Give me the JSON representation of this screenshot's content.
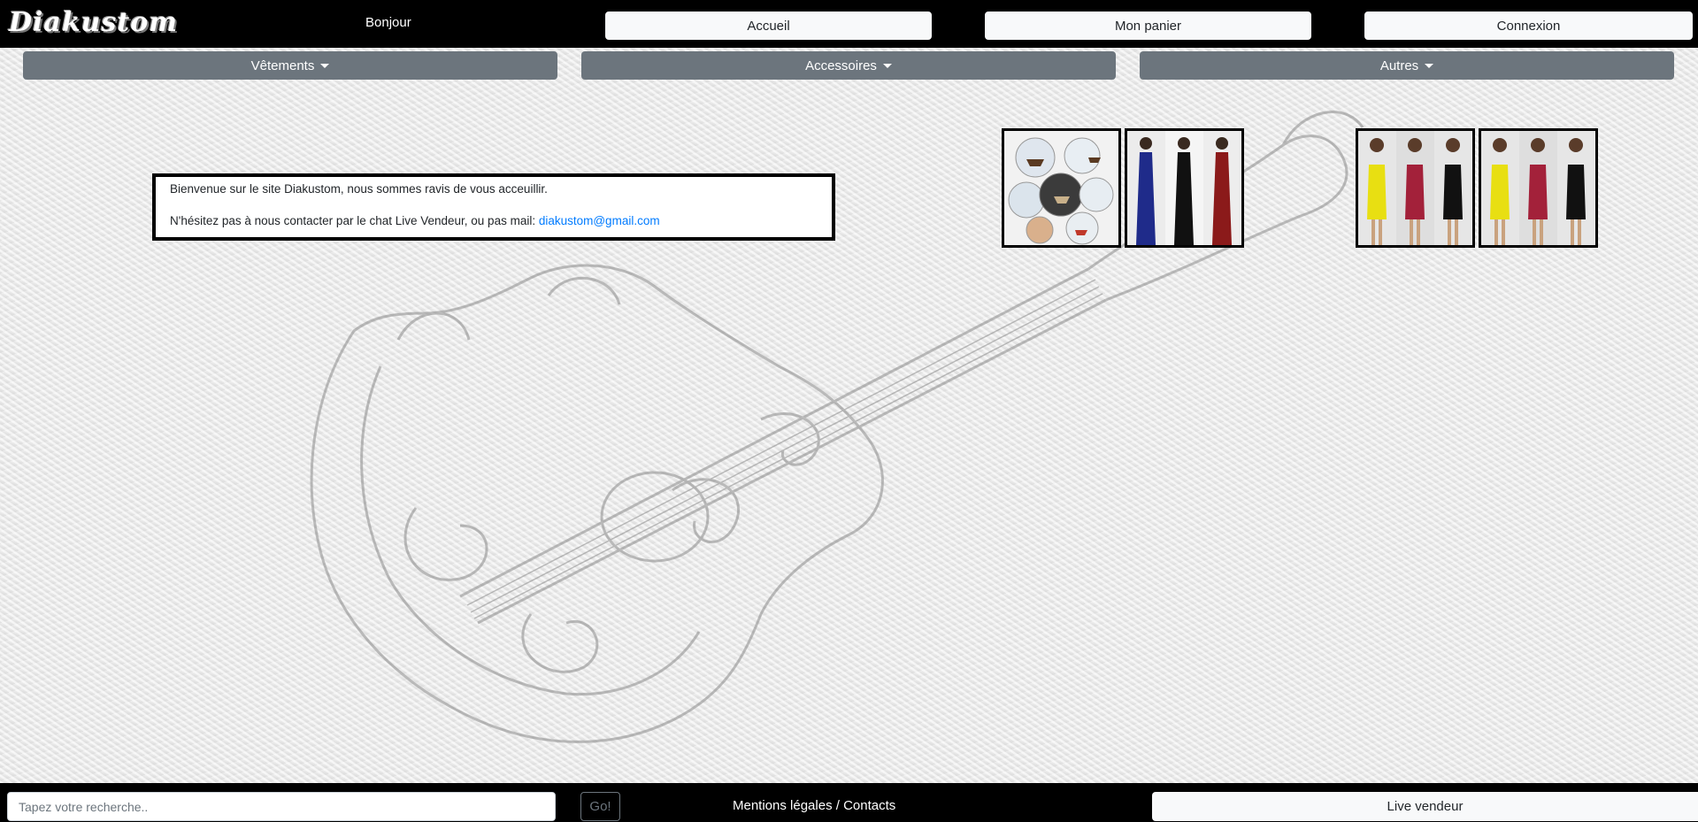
{
  "header": {
    "logo_text": "Diakustom",
    "greeting": "Bonjour",
    "nav": {
      "home_label": "Accueil",
      "cart_label": "Mon panier",
      "login_label": "Connexion"
    }
  },
  "categories": {
    "clothing_label": "Vêtements",
    "accessories_label": "Accessoires",
    "others_label": "Autres"
  },
  "welcome": {
    "line1": "Bienvenue sur le site Diakustom, nous sommes ravis de vous acceuillir.",
    "line2_prefix": "N'hésitez pas à nous contacter par le chat Live Vendeur, ou pas mail: ",
    "email": "diakustom@gmail.com"
  },
  "products": [
    {
      "icon": "pirate-ship-knobs-image"
    },
    {
      "icon": "long-dresses-image"
    },
    {
      "icon": "bodycon-dresses-image"
    },
    {
      "icon": "bodycon-dresses-image"
    }
  ],
  "footer": {
    "search_placeholder": "Tapez votre recherche..",
    "go_label": "Go!",
    "mentions_label": "Mentions légales / Contacts",
    "live_label": "Live vendeur"
  },
  "colors": {
    "topbar_bg": "#000000",
    "light_button": "#f8f9fa",
    "category_button": "#6c757d",
    "link": "#007bff"
  }
}
